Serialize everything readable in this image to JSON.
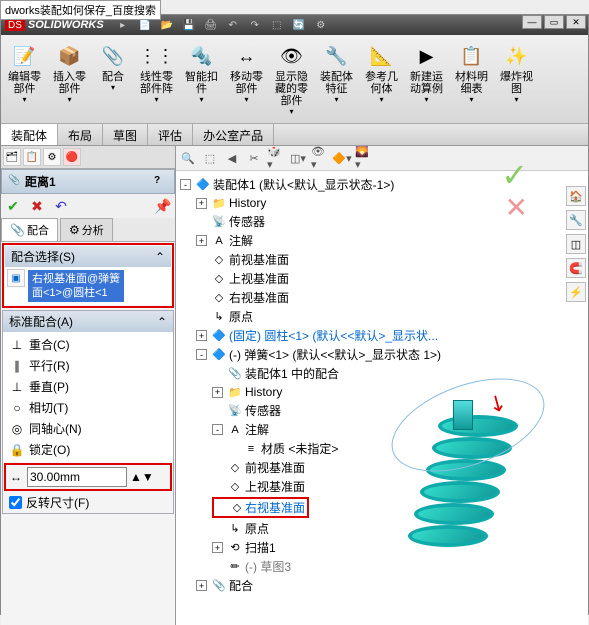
{
  "title_tab": "dworks装配如何保存_百度搜索",
  "app_name": "SOLIDWORKS",
  "main_toolbar": [
    {
      "label": "编辑零\n部件",
      "icon": "📝"
    },
    {
      "label": "插入零\n部件",
      "icon": "📦"
    },
    {
      "label": "配合",
      "icon": "📎"
    },
    {
      "label": "线性零\n部件阵",
      "icon": "⋮⋮"
    },
    {
      "label": "智能扣\n件",
      "icon": "🔩"
    },
    {
      "label": "移动零\n部件",
      "icon": "↔"
    },
    {
      "label": "显示隐\n藏的零\n部件",
      "icon": "👁"
    },
    {
      "label": "装配体\n特征",
      "icon": "🔧"
    },
    {
      "label": "参考几\n何体",
      "icon": "📐"
    },
    {
      "label": "新建运\n动算例",
      "icon": "▶"
    },
    {
      "label": "材料明\n细表",
      "icon": "📋"
    },
    {
      "label": "爆炸视\n图",
      "icon": "✨"
    }
  ],
  "tabs": [
    "装配体",
    "布局",
    "草图",
    "评估",
    "办公室产品"
  ],
  "prop_title": "距离1",
  "subtabs": [
    {
      "label": "配合",
      "icon": "📎"
    },
    {
      "label": "分析",
      "icon": "⚙"
    }
  ],
  "sect_select": "配合选择(S)",
  "selection": "右视基准面@弹簧\n面<1>@圆柱<1",
  "sect_std": "标准配合(A)",
  "mates": [
    {
      "icon": "⊥",
      "label": "重合(C)"
    },
    {
      "icon": "∥",
      "label": "平行(R)"
    },
    {
      "icon": "⊥",
      "label": "垂直(P)"
    },
    {
      "icon": "○",
      "label": "相切(T)"
    },
    {
      "icon": "◎",
      "label": "同轴心(N)"
    },
    {
      "icon": "🔒",
      "label": "锁定(O)"
    }
  ],
  "distance_value": "30.00mm",
  "reverse_label": "反转尺寸(F)",
  "tree": {
    "root": "装配体1  (默认<默认_显示状态-1>)",
    "items": [
      {
        "icon": "📁",
        "label": "History",
        "exp": "+",
        "ind": 1
      },
      {
        "icon": "📡",
        "label": "传感器",
        "ind": 1
      },
      {
        "icon": "A",
        "label": "注解",
        "exp": "+",
        "ind": 1
      },
      {
        "icon": "◇",
        "label": "前视基准面",
        "ind": 1
      },
      {
        "icon": "◇",
        "label": "上视基准面",
        "ind": 1
      },
      {
        "icon": "◇",
        "label": "右视基准面",
        "ind": 1
      },
      {
        "icon": "↳",
        "label": "原点",
        "ind": 1
      },
      {
        "icon": "🔷",
        "label": "(固定) 圆柱<1> (默认<<默认>_显示状...",
        "ind": 1,
        "blue": true,
        "exp": "+"
      },
      {
        "icon": "🔷",
        "label": "(-) 弹簧<1> (默认<<默认>_显示状态 1>)",
        "ind": 1,
        "exp": "-"
      },
      {
        "icon": "📎",
        "label": "装配体1 中的配合",
        "ind": 2
      },
      {
        "icon": "📁",
        "label": "History",
        "ind": 2,
        "exp": "+"
      },
      {
        "icon": "📡",
        "label": "传感器",
        "ind": 2
      },
      {
        "icon": "A",
        "label": "注解",
        "ind": 2,
        "exp": "-"
      },
      {
        "icon": "≡",
        "label": "材质 <未指定>",
        "ind": 3
      },
      {
        "icon": "◇",
        "label": "前视基准面",
        "ind": 2
      },
      {
        "icon": "◇",
        "label": "上视基准面",
        "ind": 2
      },
      {
        "icon": "◇",
        "label": "右视基准面",
        "ind": 2,
        "red": true,
        "blue": true
      },
      {
        "icon": "↳",
        "label": "原点",
        "ind": 2
      },
      {
        "icon": "⟲",
        "label": "扫描1",
        "ind": 2,
        "exp": "+"
      },
      {
        "icon": "✏",
        "label": "(-) 草图3",
        "ind": 2,
        "gray": true
      },
      {
        "icon": "📎",
        "label": "配合",
        "ind": 1,
        "exp": "+"
      }
    ]
  }
}
